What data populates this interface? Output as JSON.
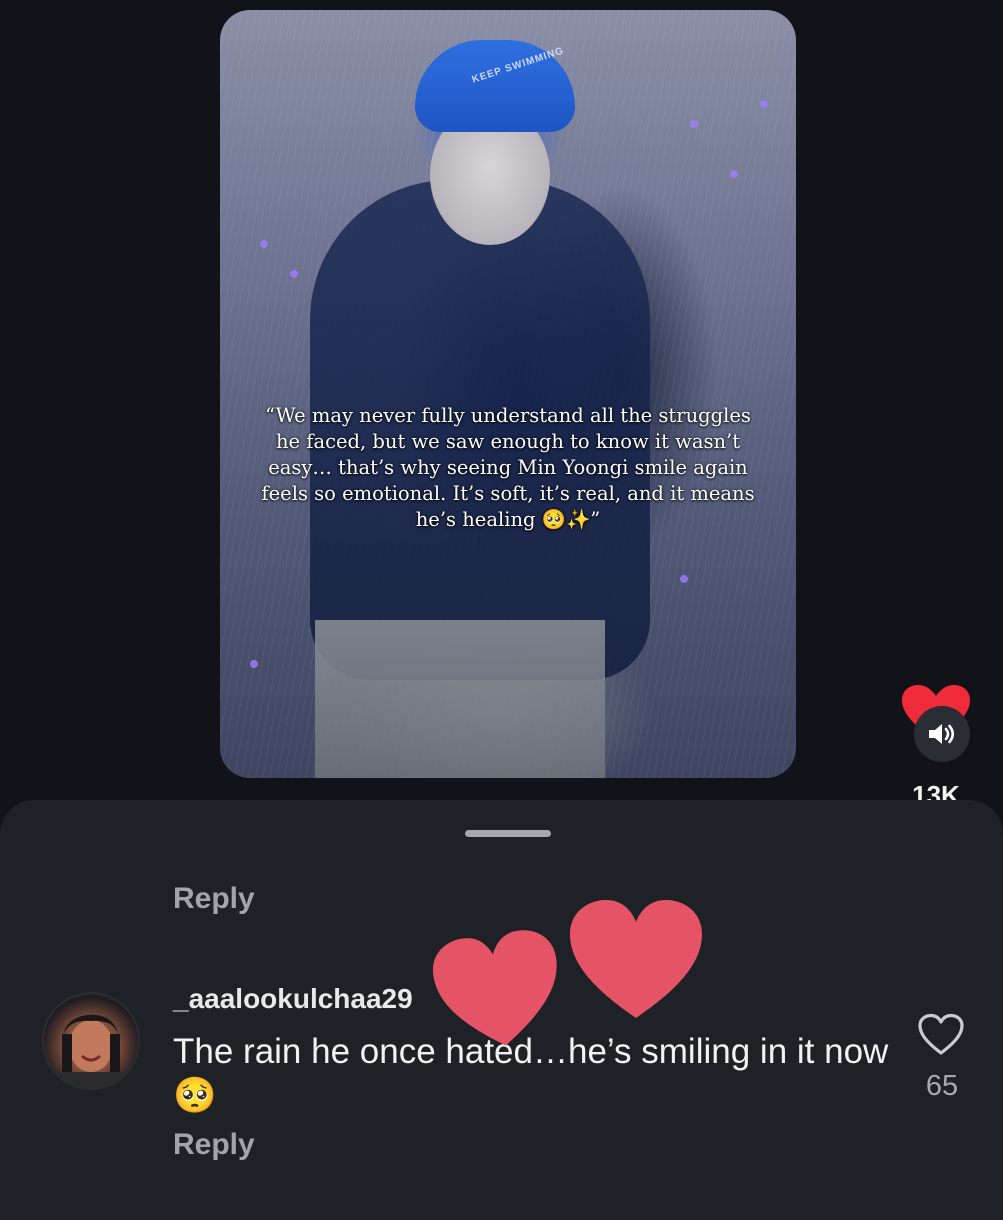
{
  "video": {
    "cap_text": "KEEP SWIMMING",
    "quote": "“We may never fully understand all the struggles he faced, but we saw enough to know it wasn’t easy… that’s why seeing Min Yoongi smile again feels so emotional. It’s soft, it’s real, and it means he’s healing 🥺✨”"
  },
  "actions": {
    "like_count": "13K",
    "like_icon": "heart-filled-icon",
    "volume_icon": "volume-icon",
    "like_color": "#ef2b3a"
  },
  "comments": {
    "top_reply_label": "Reply",
    "items": [
      {
        "username": "_aaalookulchaa29",
        "text": "The rain he once hated…he’s smiling in it now 🥺",
        "like_count": "65",
        "reply_label": "Reply"
      }
    ]
  },
  "stickers": {
    "heart_color": "#e55466"
  }
}
